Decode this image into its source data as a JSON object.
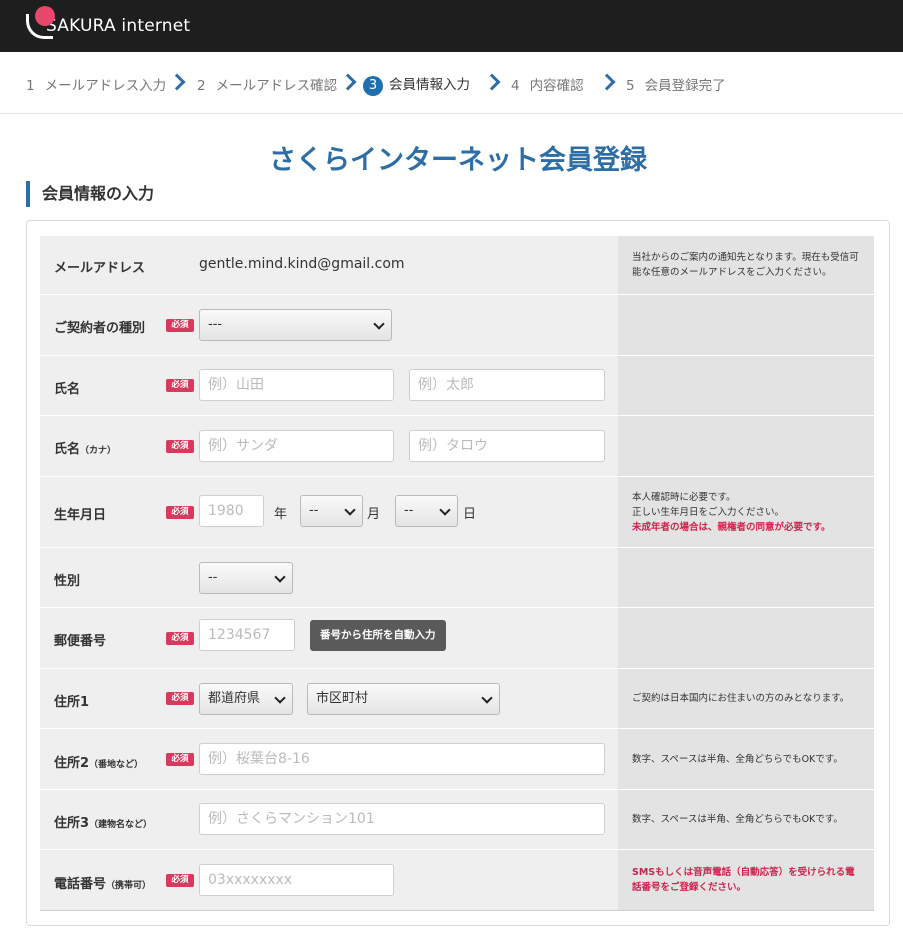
{
  "header": {
    "brand": "SAKURA internet"
  },
  "steps": [
    {
      "num": "1",
      "label": "メールアドレス入力"
    },
    {
      "num": "2",
      "label": "メールアドレス確認"
    },
    {
      "num": "3",
      "label": "会員情報入力"
    },
    {
      "num": "4",
      "label": "内容確認"
    },
    {
      "num": "5",
      "label": "会員登録完了"
    }
  ],
  "page_title": "さくらインターネット会員登録",
  "section_title": "会員情報の入力",
  "required_badge": "必須",
  "form": {
    "email": {
      "label": "メールアドレス",
      "value": "gentle.mind.kind@gmail.com",
      "note": "当社からのご案内の通知先となります。現在も受信可能な任意のメールアドレスをご入力ください。"
    },
    "contract_type": {
      "label": "ご契約者の種別",
      "selected": "---"
    },
    "name": {
      "label": "氏名",
      "last_placeholder": "例）山田",
      "first_placeholder": "例）太郎"
    },
    "name_kana": {
      "label": "氏名",
      "label_small": "（カナ）",
      "last_placeholder": "例）サンダ",
      "first_placeholder": "例）タロウ"
    },
    "birthday": {
      "label": "生年月日",
      "year_placeholder": "1980",
      "year_unit": "年",
      "month_selected": "--",
      "month_unit": "月",
      "day_selected": "--",
      "day_unit": "日",
      "note_line1": "本人確認時に必要です。",
      "note_line2": "正しい生年月日をご入力ください。",
      "note_warning": "未成年者の場合は、親権者の同意が必要です。"
    },
    "gender": {
      "label": "性別",
      "selected": "--"
    },
    "postal": {
      "label": "郵便番号",
      "placeholder": "1234567",
      "button": "番号から住所を自動入力"
    },
    "address1": {
      "label": "住所1",
      "prefecture_selected": "都道府県",
      "city_selected": "市区町村",
      "note": "ご契約は日本国内にお住まいの方のみとなります。"
    },
    "address2": {
      "label": "住所2",
      "label_small": "（番地など）",
      "placeholder": "例）桜葉台8-16",
      "note": "数字、スペースは半角、全角どちらでもOKです。"
    },
    "address3": {
      "label": "住所3",
      "label_small": "（建物名など）",
      "placeholder": "例）さくらマンション101",
      "note": "数字、スペースは半角、全角どちらでもOKです。"
    },
    "phone": {
      "label": "電話番号",
      "label_small": "（携帯可）",
      "placeholder": "03xxxxxxxx",
      "note": "SMSもしくは音声電話（自動応答）を受けられる電話番号をご登録ください。"
    }
  },
  "colors": {
    "brand_blue": "#2c6ea5",
    "required_red": "#d63a5d",
    "header_bg": "#1e1e1e"
  }
}
